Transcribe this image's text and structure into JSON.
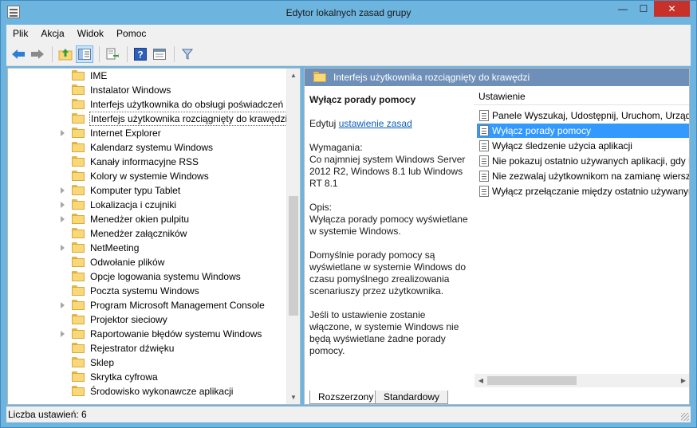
{
  "window": {
    "title": "Edytor lokalnych zasad grupy",
    "minimize": "—",
    "maximize": "☐",
    "close": "✕"
  },
  "menu": [
    "Plik",
    "Akcja",
    "Widok",
    "Pomoc"
  ],
  "toolbar": {
    "icons": [
      "back-icon",
      "forward-icon",
      "up-folder-icon",
      "show-tree-icon",
      "export-list-icon",
      "help-icon",
      "properties-icon",
      "filter-icon"
    ]
  },
  "tree": {
    "items": [
      {
        "label": "IME",
        "expandable": false
      },
      {
        "label": "Instalator Windows",
        "expandable": false
      },
      {
        "label": "Interfejs użytkownika do obsługi poświadczeń",
        "expandable": false
      },
      {
        "label": "Interfejs użytkownika rozciągnięty do krawędzi",
        "expandable": false,
        "selected": true
      },
      {
        "label": "Internet Explorer",
        "expandable": true
      },
      {
        "label": "Kalendarz systemu Windows",
        "expandable": false
      },
      {
        "label": "Kanały informacyjne RSS",
        "expandable": false
      },
      {
        "label": "Kolory w systemie Windows",
        "expandable": false
      },
      {
        "label": "Komputer typu Tablet",
        "expandable": true
      },
      {
        "label": "Lokalizacja i czujniki",
        "expandable": true
      },
      {
        "label": "Menedżer okien pulpitu",
        "expandable": true
      },
      {
        "label": "Menedżer załączników",
        "expandable": false
      },
      {
        "label": "NetMeeting",
        "expandable": true
      },
      {
        "label": "Odwołanie plików",
        "expandable": false
      },
      {
        "label": "Opcje logowania systemu Windows",
        "expandable": false
      },
      {
        "label": "Poczta systemu Windows",
        "expandable": false
      },
      {
        "label": "Program Microsoft Management Console",
        "expandable": true
      },
      {
        "label": "Projektor sieciowy",
        "expandable": false
      },
      {
        "label": "Raportowanie błędów systemu Windows",
        "expandable": true
      },
      {
        "label": "Rejestrator dźwięku",
        "expandable": false
      },
      {
        "label": "Sklep",
        "expandable": false
      },
      {
        "label": "Skrytka cyfrowa",
        "expandable": false
      },
      {
        "label": "Środowisko wykonawcze aplikacji",
        "expandable": false
      }
    ]
  },
  "details": {
    "header": "Interfejs użytkownika rozciągnięty do krawędzi",
    "policy_title": "Wyłącz porady pomocy",
    "edit_prefix": "Edytuj",
    "edit_link": "ustawienie zasad",
    "requirements_label": "Wymagania:",
    "requirements_text": "Co najmniej system Windows Server 2012 R2, Windows 8.1 lub Windows RT 8.1",
    "description_label": "Opis:",
    "description_p1": "Wyłącza porady pomocy wyświetlane w systemie Windows.",
    "description_p2": "Domyślnie porady pomocy są wyświetlane w systemie Windows do czasu pomyślnego zrealizowania scenariuszy przez użytkownika.",
    "description_p3": "Jeśli to ustawienie zostanie włączone, w systemie Windows nie będą wyświetlane żadne porady pomocy."
  },
  "settings": {
    "column": "Ustawienie",
    "items": [
      {
        "label": "Panele Wyszukaj, Udostępnij, Uruchom, Urządz"
      },
      {
        "label": "Wyłącz porady pomocy",
        "selected": true
      },
      {
        "label": "Wyłącz śledzenie użycia aplikacji"
      },
      {
        "label": "Nie pokazuj ostatnio używanych aplikacji, gdy k"
      },
      {
        "label": "Nie zezwalaj użytkownikom na zamianę wiersza"
      },
      {
        "label": "Wyłącz przełączanie między ostatnio używanym"
      }
    ]
  },
  "tabs": [
    "Rozszerzony",
    "Standardowy"
  ],
  "status": "Liczba ustawień: 6"
}
